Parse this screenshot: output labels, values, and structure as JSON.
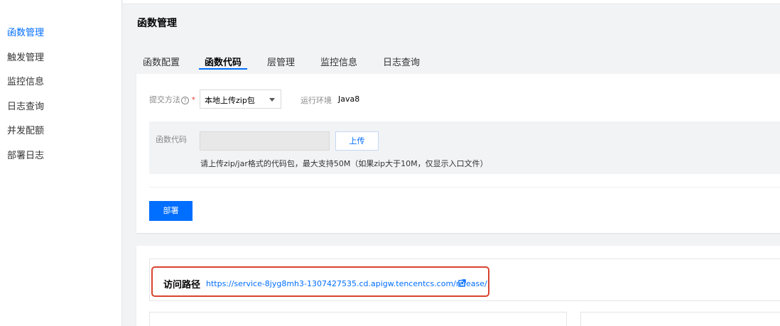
{
  "sidebar": {
    "items": [
      {
        "label": "函数管理",
        "active": true
      },
      {
        "label": "触发管理"
      },
      {
        "label": "监控信息"
      },
      {
        "label": "日志查询"
      },
      {
        "label": "并发配额"
      },
      {
        "label": "部署日志"
      }
    ]
  },
  "page": {
    "title": "函数管理"
  },
  "tabs": [
    {
      "label": "函数配置"
    },
    {
      "label": "函数代码",
      "active": true
    },
    {
      "label": "层管理"
    },
    {
      "label": "监控信息"
    },
    {
      "label": "日志查询"
    }
  ],
  "form": {
    "submit_method_label": "提交方法",
    "help_glyph": "?",
    "required_mark": "*",
    "submit_method_value": "本地上传zip包",
    "runtime_label": "运行环境",
    "runtime_value": "Java8",
    "code_label": "函数代码",
    "upload_label": "上传",
    "hint": "请上传zip/jar格式的代码包，最大支持50M（如果zip大于10M，仅显示入口文件）",
    "deploy_label": "部署"
  },
  "access": {
    "label": "访问路径",
    "url": "https://service-8jyg8mh3-1307427535.cd.apigw.tencentcs.com/release/"
  },
  "colors": {
    "accent": "#006eff",
    "highlight": "#d9432f"
  },
  "icons": {
    "external_link": "external-link-icon",
    "caret": "chevron-down-icon",
    "help": "question-circle-icon"
  }
}
